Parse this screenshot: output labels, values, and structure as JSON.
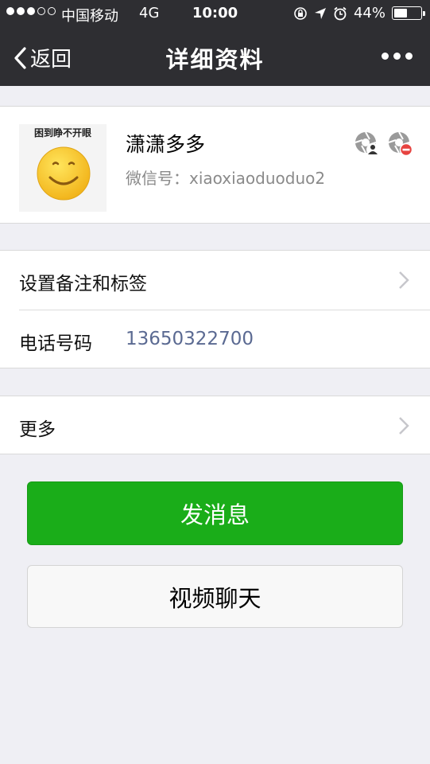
{
  "status_bar": {
    "carrier": "中国移动",
    "network": "4G",
    "time": "10:00",
    "battery": "44%",
    "battery_level": 0.44,
    "signal_bars_filled": 3,
    "signal_bars_total": 5
  },
  "nav": {
    "back_label": "返回",
    "title": "详细资料"
  },
  "profile": {
    "avatar_caption": "困到睁不开眼",
    "name": "潇潇多多",
    "wechat_id_label": "微信号：",
    "wechat_id": "xiaoxiaoduoduo2"
  },
  "info": {
    "remark_label": "设置备注和标签",
    "phone_label": "电话号码",
    "phone_value": "13650322700",
    "more_label": "更多"
  },
  "actions": {
    "send_message": "发消息",
    "video_call": "视频聊天"
  },
  "colors": {
    "nav_bg": "#2e2e32",
    "primary_green": "#1aad19",
    "link_blue_gray": "#5b6a92",
    "page_bg": "#efeff4"
  }
}
